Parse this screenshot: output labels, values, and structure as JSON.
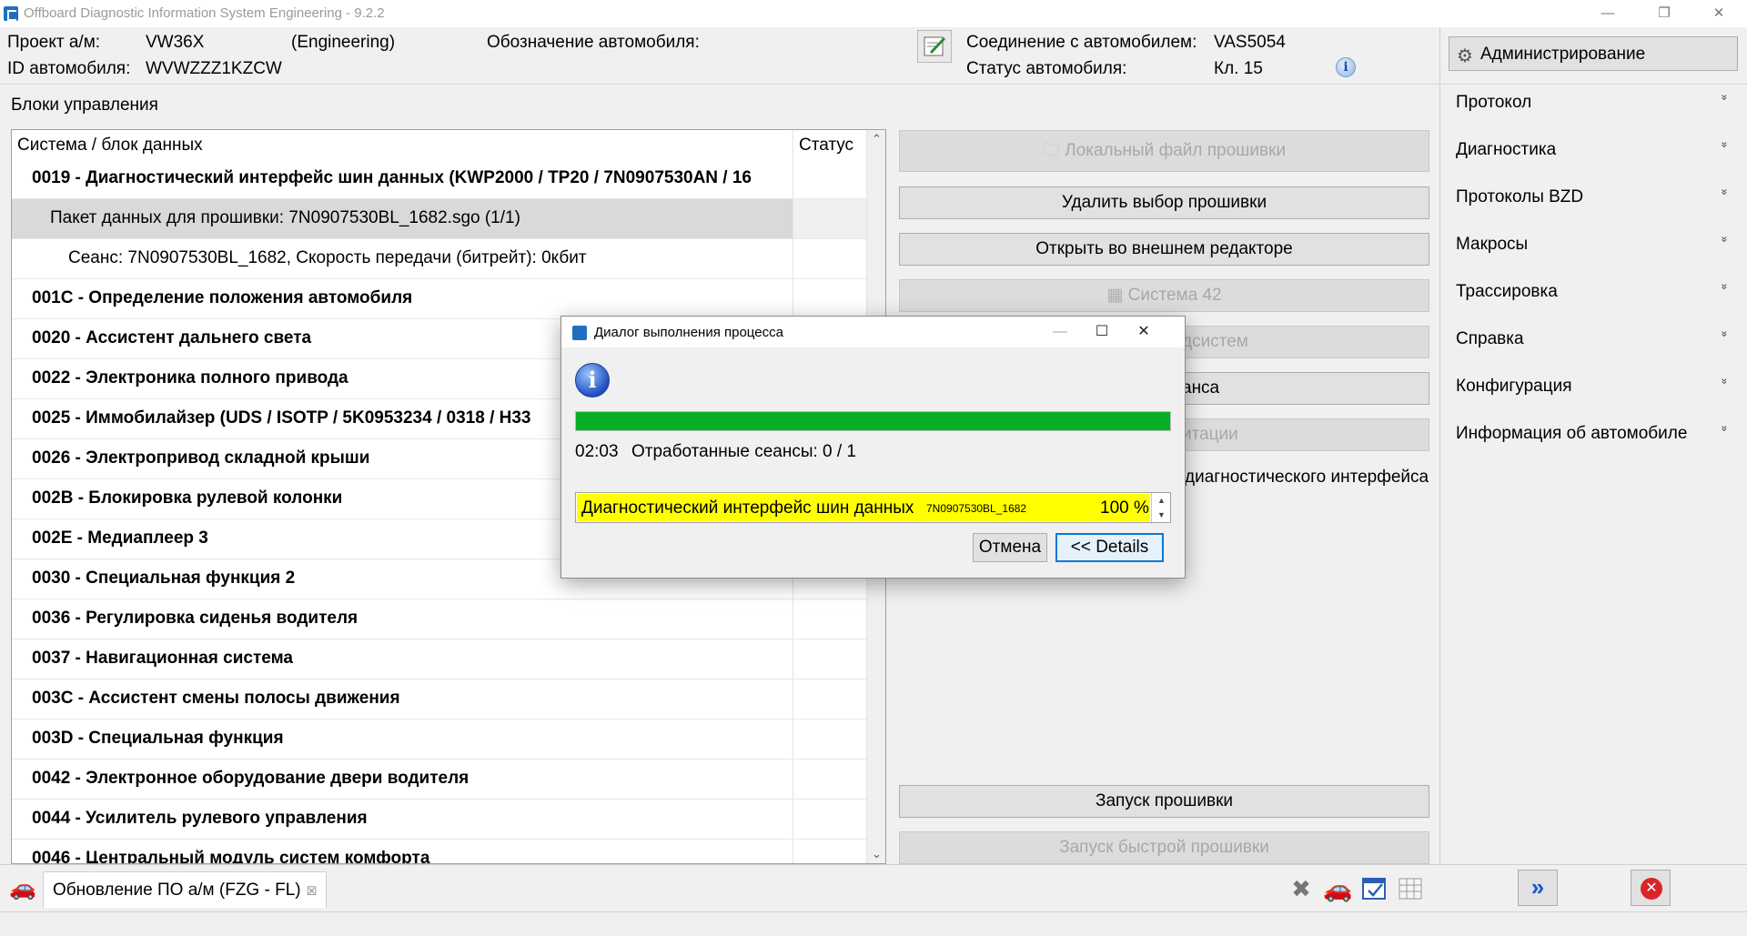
{
  "window": {
    "title": "Offboard Diagnostic Information System Engineering - 9.2.2",
    "minimize": "—",
    "restore": "❐",
    "close": "✕"
  },
  "header": {
    "project_label": "Проект а/м:",
    "project_value": "VW36X",
    "project_mode": "(Engineering)",
    "vehicle_designation_label": "Обозначение автомобиля:",
    "vehicle_id_label": "ID автомобиля:",
    "vehicle_id_value": "WVWZZZ1KZCW",
    "connection_label": "Соединение с автомобилем:",
    "connection_value": "VAS5054",
    "status_label": "Статус автомобиля:",
    "status_value": "Кл. 15",
    "info_icon": "i"
  },
  "blocks": {
    "title": "Блоки управления",
    "col_system": "Система / блок данных",
    "col_status": "Статус",
    "rows": [
      {
        "text": "0019 - Диагностический интерфейс шин данных  (KWP2000 / TP20 / 7N0907530AN / 16",
        "indent": 0,
        "bold": true,
        "selected": false
      },
      {
        "text": "Пакет данных для прошивки: 7N0907530BL_1682.sgo (1/1)",
        "indent": 1,
        "bold": false,
        "selected": true
      },
      {
        "text": "Сеанс: 7N0907530BL_1682, Скорость передачи (битрейт): 0кбит",
        "indent": 2,
        "bold": false,
        "selected": false
      },
      {
        "text": "001C - Определение положения автомобиля",
        "indent": 0,
        "bold": true,
        "selected": false
      },
      {
        "text": "0020 - Ассистент дальнего света",
        "indent": 0,
        "bold": true,
        "selected": false
      },
      {
        "text": "0022 - Электроника полного привода",
        "indent": 0,
        "bold": true,
        "selected": false
      },
      {
        "text": "0025 - Иммобилайзер  (UDS / ISOTP / 5K0953234 / 0318 / H33",
        "indent": 0,
        "bold": true,
        "selected": false
      },
      {
        "text": "0026 - Электропривод складной крыши",
        "indent": 0,
        "bold": true,
        "selected": false
      },
      {
        "text": "002B - Блокировка рулевой колонки",
        "indent": 0,
        "bold": true,
        "selected": false
      },
      {
        "text": "002E - Медиаплеер 3",
        "indent": 0,
        "bold": true,
        "selected": false
      },
      {
        "text": "0030 - Специальная функция 2",
        "indent": 0,
        "bold": true,
        "selected": false
      },
      {
        "text": "0036 - Регулировка сиденья водителя",
        "indent": 0,
        "bold": true,
        "selected": false
      },
      {
        "text": "0037 - Навигационная система",
        "indent": 0,
        "bold": true,
        "selected": false
      },
      {
        "text": "003C - Ассистент смены полосы движения",
        "indent": 0,
        "bold": true,
        "selected": false
      },
      {
        "text": "003D - Специальная функция",
        "indent": 0,
        "bold": true,
        "selected": false
      },
      {
        "text": "0042 - Электронное оборудование двери водителя",
        "indent": 0,
        "bold": true,
        "selected": false
      },
      {
        "text": "0044 - Усилитель рулевого управления",
        "indent": 0,
        "bold": true,
        "selected": false
      },
      {
        "text": "0046 - Центральный модуль систем комфорта",
        "indent": 0,
        "bold": true,
        "selected": false
      }
    ]
  },
  "actions": {
    "local_file": "Локальный файл прошивки",
    "deselect": "Удалить выбор прошивки",
    "open_editor": "Открыть во внешнем редакторе",
    "system42": "Система 42",
    "hidden1": "дсистем",
    "hidden2": "анса",
    "hidden3": "итации",
    "diag_tail": "диагностического интерфейса",
    "start_flash": "Запуск прошивки",
    "start_fast_flash": "Запуск быстрой прошивки"
  },
  "right_menu": {
    "admin": "Администрирование",
    "items": [
      "Протокол",
      "Диагностика",
      "Протоколы BZD",
      "Макросы",
      "Трассировка",
      "Справка",
      "Конфигурация",
      "Информация об автомобиле"
    ],
    "chevron": "»"
  },
  "bottom": {
    "tab_label": "Обновление ПО а/м (FZG - FL)",
    "tab_close": "☒"
  },
  "dialog": {
    "title": "Диалог выполнения процесса",
    "progress": 1.0,
    "time": "02:03",
    "sessions": "Отработанные сеансы: 0 / 1",
    "item_name": "Диагностический интерфейс шин данных",
    "item_file": "7N0907530BL_1682",
    "item_percent": "100 %",
    "cancel": "Отмена",
    "details": "<< Details",
    "info_icon": "i"
  },
  "colors": {
    "progress_green": "#06b025",
    "item_highlight": "#ffff00",
    "accent_blue": "#0a78d7",
    "close_red": "#d9242a"
  }
}
